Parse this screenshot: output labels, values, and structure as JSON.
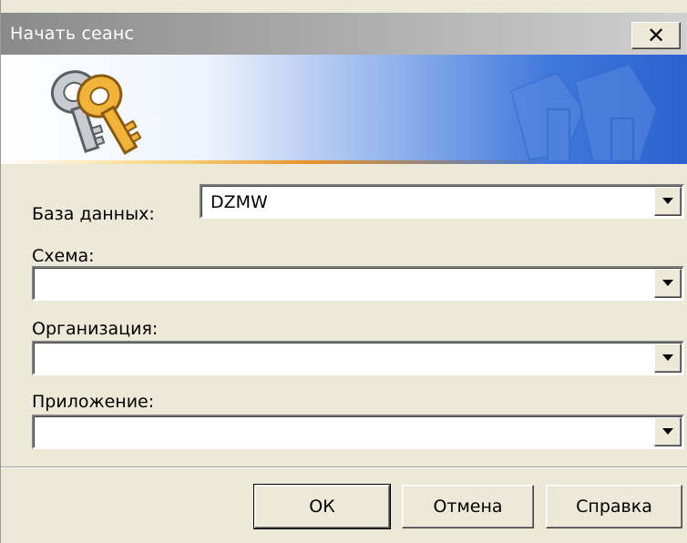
{
  "window": {
    "title": "Начать сеанс",
    "close_symbol": "✕"
  },
  "icons": {
    "banner": "keys-icon",
    "dropdown": "triangle-down-icon"
  },
  "fields": {
    "database": {
      "label": "База данных:",
      "value": "DZMW"
    },
    "schema": {
      "label": "Схема:",
      "value": ""
    },
    "organization": {
      "label": "Организация:",
      "value": ""
    },
    "application": {
      "label": "Приложение:",
      "value": ""
    }
  },
  "buttons": {
    "ok": "ОК",
    "cancel": "Отмена",
    "help": "Справка"
  },
  "colors": {
    "title_bar": "#9a9a9a",
    "banner_blue": "#2a61cf",
    "dialog_face": "#ece9d8"
  }
}
